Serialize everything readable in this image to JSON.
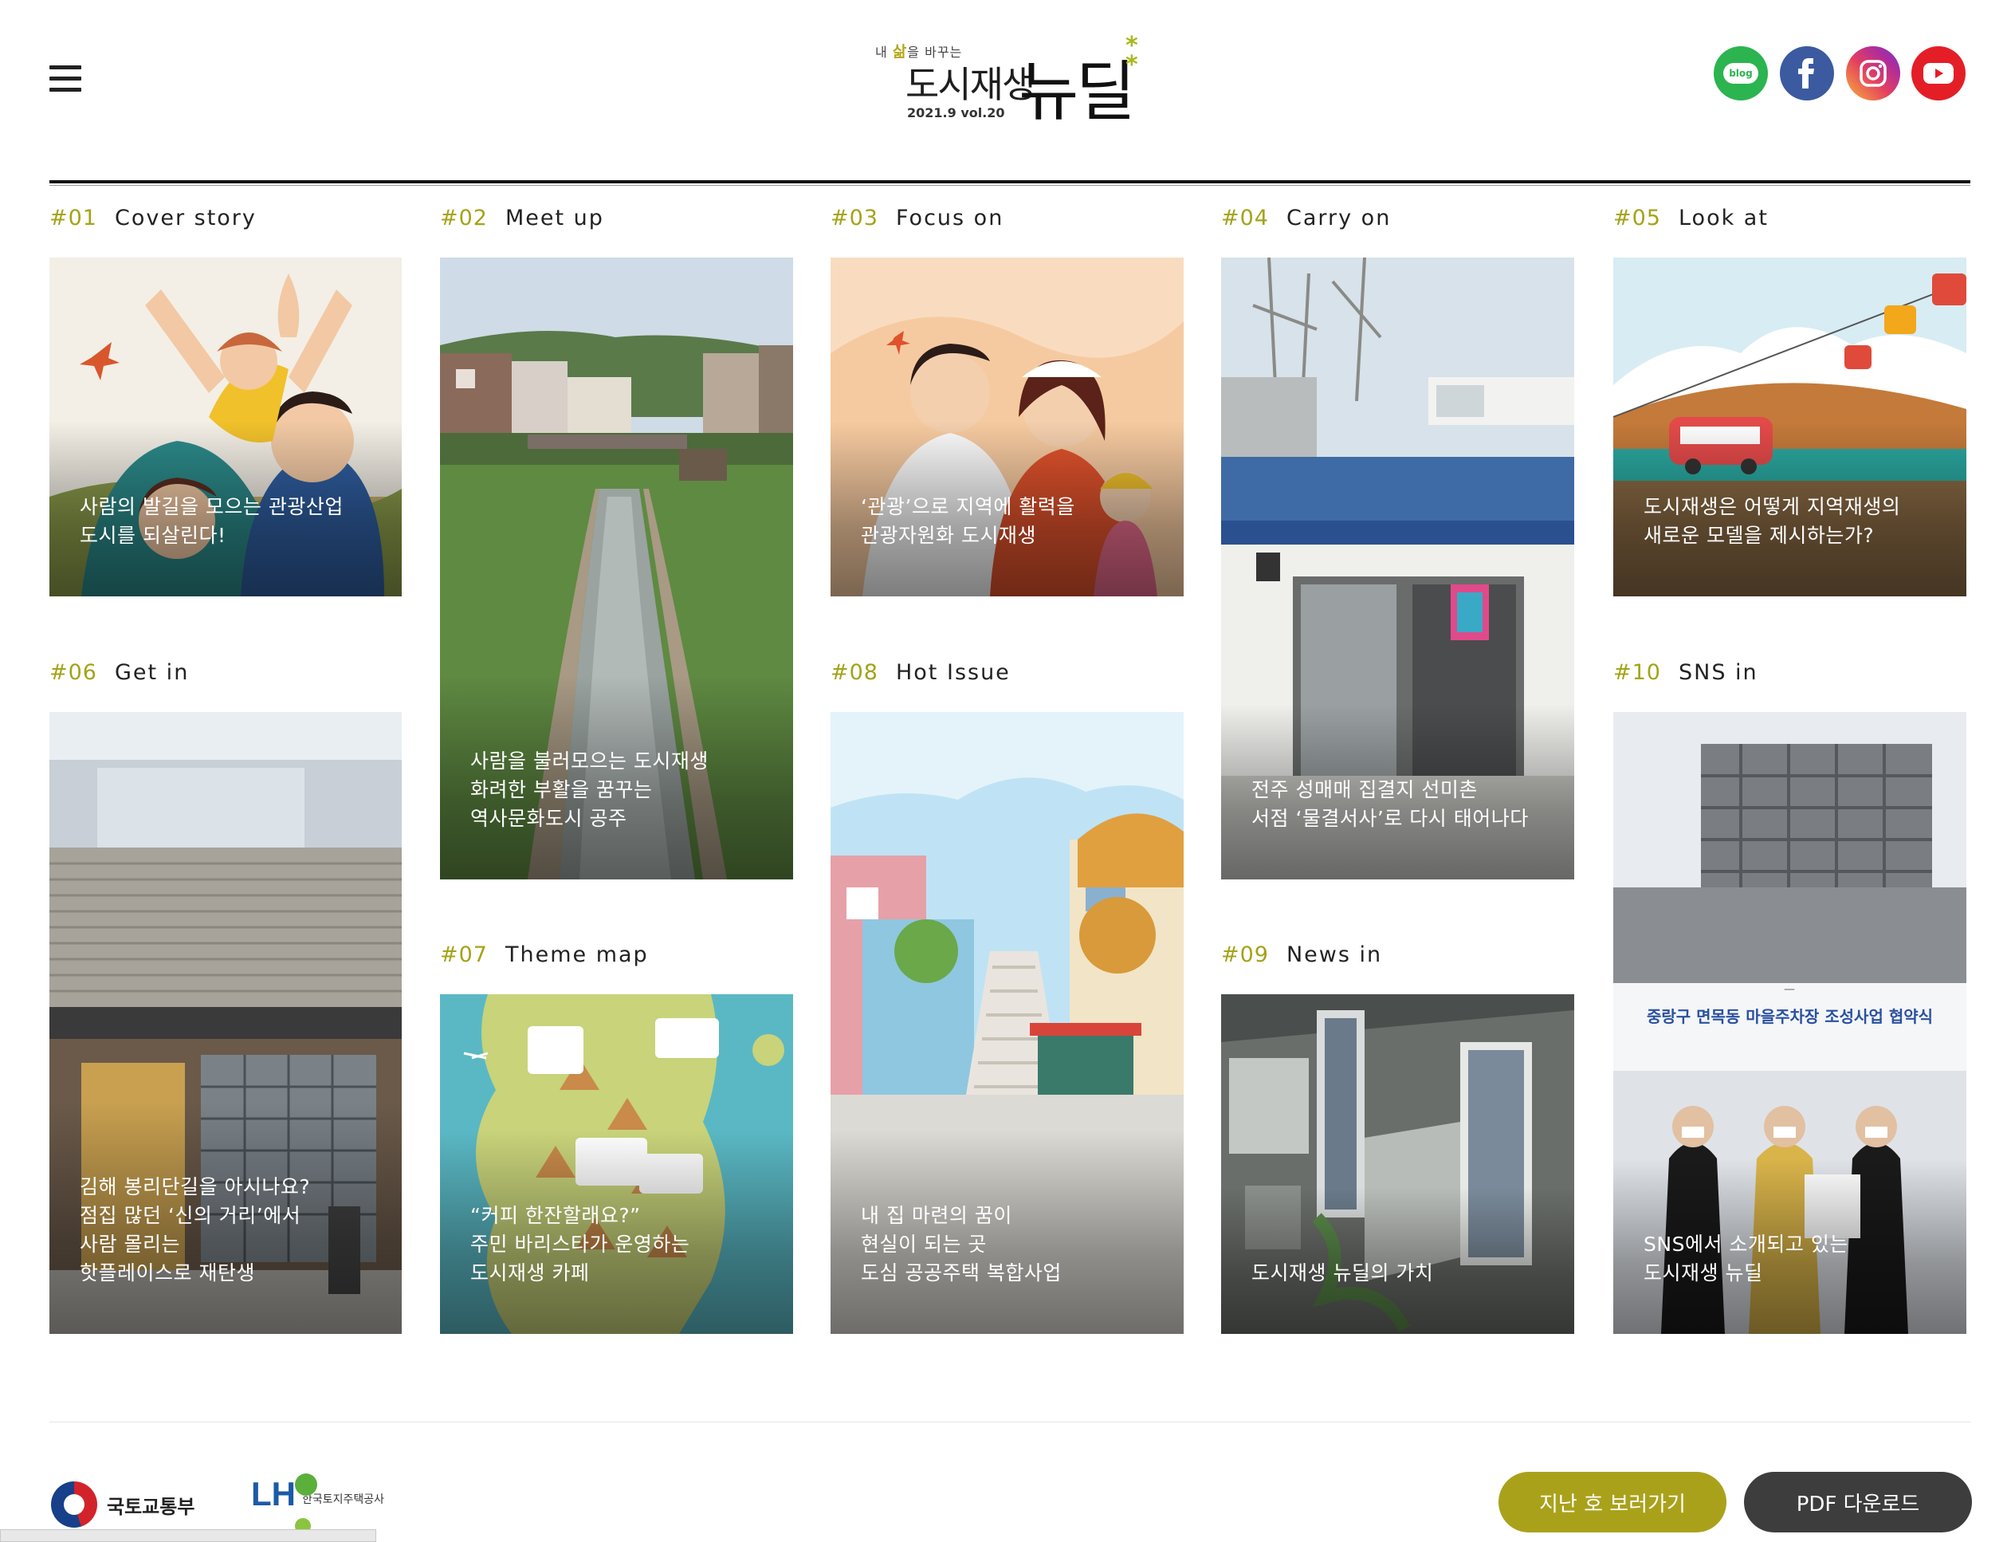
{
  "header": {
    "logo": {
      "tagline_pre": "내 ",
      "tagline_em": "삶",
      "tagline_post": "을 바꾸는",
      "main": "도시재생",
      "big": "뉴딜",
      "issue": "2021.9  vol.20"
    },
    "social": [
      {
        "icon": "blog-icon",
        "label": "blog"
      },
      {
        "icon": "facebook-icon",
        "label": "f"
      },
      {
        "icon": "instagram-icon",
        "label": ""
      },
      {
        "icon": "youtube-icon",
        "label": ""
      }
    ]
  },
  "sections": [
    {
      "num": "#01",
      "title": "Cover story",
      "caption": [
        "사람의 발길을 모으는 관광산업",
        "도시를 되살린다!"
      ]
    },
    {
      "num": "#02",
      "title": "Meet up",
      "caption": [
        "사람을 불러모으는 도시재생",
        "화려한 부활을 꿈꾸는",
        "역사문화도시 공주"
      ]
    },
    {
      "num": "#03",
      "title": "Focus on",
      "caption": [
        "‘관광’으로 지역에 활력을",
        "관광자원화 도시재생"
      ]
    },
    {
      "num": "#04",
      "title": "Carry on",
      "caption": [
        "전주 성매매 집결지 선미촌",
        "서점 ‘물결서사’로 다시 태어나다"
      ]
    },
    {
      "num": "#05",
      "title": "Look at",
      "caption": [
        "도시재생은 어떻게 지역재생의",
        "새로운 모델을 제시하는가?"
      ]
    },
    {
      "num": "#06",
      "title": "Get in",
      "caption": [
        "김해 봉리단길을 아시나요?",
        "점집 많던 ‘신의 거리’에서",
        "사람 몰리는",
        "핫플레이스로 재탄생"
      ]
    },
    {
      "num": "#07",
      "title": "Theme map",
      "caption": [
        "“커피 한잔할래요?”",
        "주민 바리스타가 운영하는",
        "도시재생 카페"
      ]
    },
    {
      "num": "#08",
      "title": "Hot Issue",
      "caption": [
        "내 집 마련의 꿈이",
        "현실이 되는 곳",
        "도심 공공주택 복합사업"
      ]
    },
    {
      "num": "#09",
      "title": "News in",
      "caption": [
        "도시재생 뉴딜의 가치"
      ]
    },
    {
      "num": "#10",
      "title": "SNS in",
      "caption": [
        "SNS에서 소개되고 있는",
        "도시재생 뉴딜"
      ]
    }
  ],
  "card_photo_texts": {
    "s10_banner": "중랑구 면목동 마을주차장 조성사업 협약식"
  },
  "footer": {
    "molit": "국토교통부",
    "lh_mark": "LH",
    "lh_sub": "한국토지주택공사",
    "btn_prev": "지난 호 보러가기",
    "btn_pdf": "PDF 다운로드"
  },
  "colors": {
    "accent": "#aaa11b",
    "dark_button": "#3d3d3d"
  }
}
